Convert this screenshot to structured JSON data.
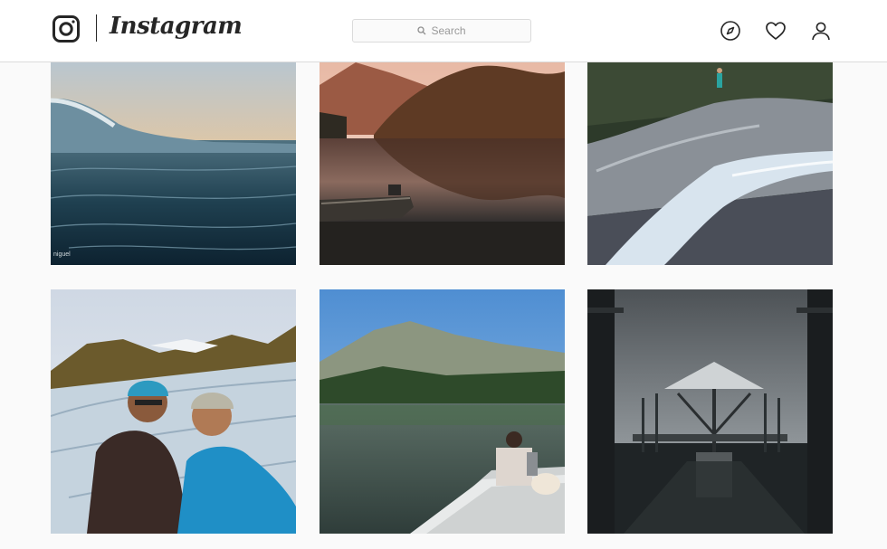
{
  "header": {
    "brand": "Instagram",
    "search_placeholder": "Search",
    "icons": [
      "instagram-glyph-icon",
      "search-icon",
      "compass-icon",
      "heart-icon",
      "profile-icon"
    ]
  },
  "posts": [
    {
      "subject": "ocean wave at sunset",
      "watermark": "niguel"
    },
    {
      "subject": "lake reflection with boat"
    },
    {
      "subject": "waterfall over granite slab"
    },
    {
      "subject": "glacier selfie with helmets"
    },
    {
      "subject": "boat on mountain lake with dog"
    },
    {
      "subject": "pavilion over reflecting pool"
    }
  ],
  "colors": {
    "text": "#262626",
    "border": "#dbdbdb",
    "background": "#fafafa"
  }
}
